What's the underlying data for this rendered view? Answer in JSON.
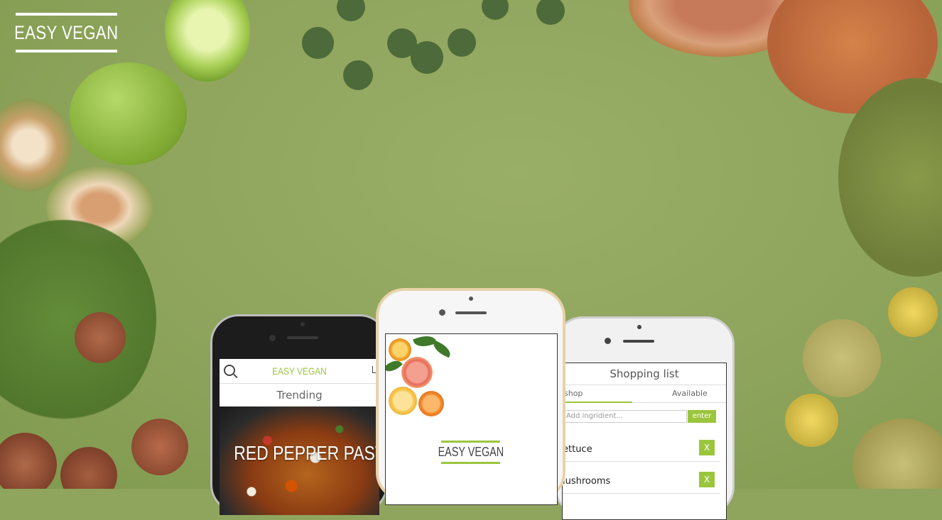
{
  "brand": {
    "logo": "EASY VEGAN"
  },
  "phone_left": {
    "app_logo": "EASY VEGAN",
    "section": "Trending",
    "recipe_title": "RED PEPPER PASTA"
  },
  "phone_center": {
    "splash_logo": "EASY VEGAN"
  },
  "phone_right": {
    "title": "Shopping list",
    "tabs": [
      "shop",
      "Available"
    ],
    "input_placeholder": "Add ingridient...",
    "enter_label": "enter",
    "items": [
      {
        "label": "ettuce",
        "remove": "X"
      },
      {
        "label": "lushrooms",
        "remove": "X"
      }
    ]
  },
  "colors": {
    "accent": "#9bc53d",
    "background": "#8fa55e"
  }
}
